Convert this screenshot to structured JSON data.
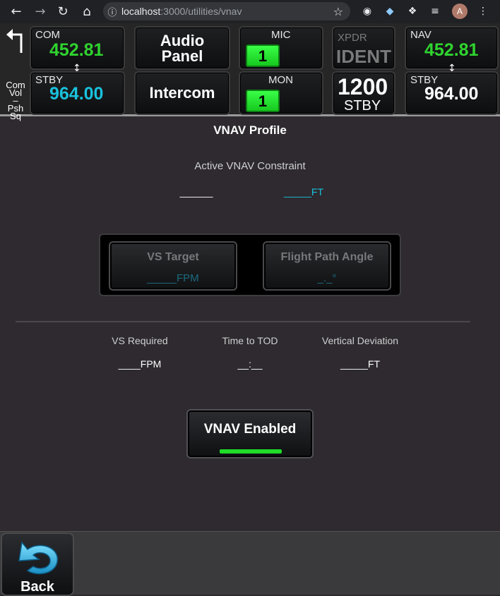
{
  "browser": {
    "url_host": "localhost",
    "url_rest": ":3000/utilities/vnav",
    "avatar_initial": "A"
  },
  "topbar": {
    "com_vol": [
      "Com",
      "Vol",
      "–",
      "Psh",
      "Sq"
    ],
    "com": {
      "label": "COM",
      "active": "452.81",
      "stby_label": "STBY",
      "standby": "964.00"
    },
    "audio_panel": {
      "line1": "Audio",
      "line2": "Panel"
    },
    "intercom": "Intercom",
    "mic": {
      "label": "MIC",
      "value": "1"
    },
    "mon": {
      "label": "MON",
      "value": "1"
    },
    "xpdr": {
      "label": "XPDR",
      "ident": "IDENT",
      "code": "1200",
      "mode": "STBY"
    },
    "nav": {
      "label": "NAV",
      "active": "452.81",
      "stby_label": "STBY",
      "standby": "964.00"
    }
  },
  "main": {
    "title": "VNAV Profile",
    "active_constraint_label": "Active VNAV Constraint",
    "constraint_waypoint": "______",
    "constraint_altitude": "_____FT",
    "vs_target": {
      "title": "VS Target",
      "value": "_____FPM"
    },
    "fpa": {
      "title": "Flight Path Angle",
      "value": "_._°"
    },
    "vs_required": {
      "label": "VS Required",
      "value": "____FPM"
    },
    "time_to_tod": {
      "label": "Time to TOD",
      "value": "__:__"
    },
    "vertical_deviation": {
      "label": "Vertical Deviation",
      "value": "_____FT"
    },
    "vnav_button": "VNAV Enabled"
  },
  "footer": {
    "back": "Back"
  },
  "colors": {
    "green": "#2fd42f",
    "cyan": "#19c2dc",
    "enabled_bar": "#1fdc28"
  }
}
